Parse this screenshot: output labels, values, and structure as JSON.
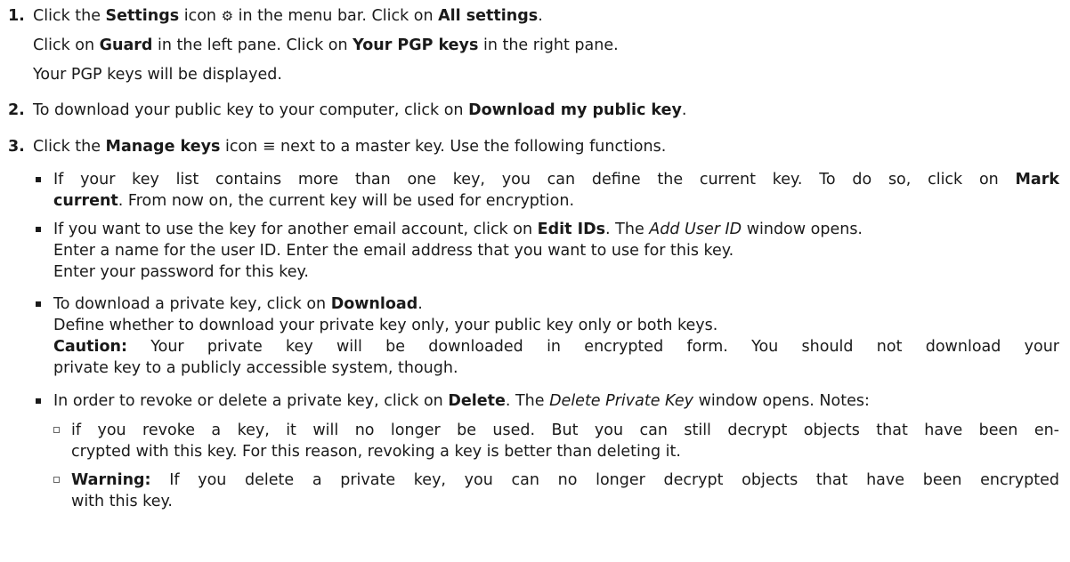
{
  "steps": [
    {
      "number": "1.",
      "lines": [
        [
          "Click the ",
          {
            "b": "Settings"
          },
          " icon ",
          {
            "icon": "⚙"
          },
          " in the menu bar. Click on ",
          {
            "b": "All settings"
          },
          "."
        ],
        [
          "Click on ",
          {
            "b": "Guard"
          },
          " in the left pane. Click on ",
          {
            "b": "Your PGP keys"
          },
          " in the right pane."
        ],
        [
          "Your PGP keys will be displayed."
        ]
      ]
    },
    {
      "number": "2.",
      "lines": [
        [
          "To download your public key to your computer, click on ",
          {
            "b": "Download my public key"
          },
          "."
        ]
      ]
    },
    {
      "number": "3.",
      "lines": [
        [
          "Click the ",
          {
            "b": "Manage keys"
          },
          " icon ",
          {
            "icon": "≡"
          },
          " next to a master key. Use the following functions."
        ]
      ]
    }
  ],
  "bullets": [
    {
      "lines": [
        [
          "If your key list contains more than one key, you can define the current key. To do so, click on ",
          {
            "b": "Mark"
          }
        ],
        [
          {
            "b": "current"
          },
          ". From now on, the current key will be used for encryption."
        ]
      ],
      "justify_first": true
    },
    {
      "lines": [
        [
          "If you want to use the key for another email account, click on ",
          {
            "b": "Edit IDs"
          },
          ". The ",
          {
            "i": "Add User ID"
          },
          " window opens."
        ],
        [
          "Enter a name for the user ID. Enter the email address that you want to use for this key."
        ],
        [
          "Enter your password for this key."
        ]
      ]
    },
    {
      "lines": [
        [
          "To download a private key, click on ",
          {
            "b": "Download"
          },
          "."
        ],
        [
          "Define whether to download your private key only, your public key only or both keys."
        ],
        [
          {
            "b": "Caution:"
          },
          " Your private key will be downloaded in encrypted form. You should not download your"
        ],
        [
          "private key to a publicly accessible system, though."
        ]
      ],
      "justify_line": 2
    },
    {
      "lines": [
        [
          "In order to revoke or delete a private key, click on ",
          {
            "b": "Delete"
          },
          ". The ",
          {
            "i": "Delete Private Key"
          },
          " window opens. Notes:"
        ]
      ]
    }
  ],
  "subbullets": [
    {
      "lines": [
        [
          "if you revoke a key, it will no longer be used. But you can still decrypt objects that have been en-"
        ],
        [
          "crypted with this key. For this reason, revoking a key is better than deleting it."
        ]
      ],
      "justify_first": true
    },
    {
      "lines": [
        [
          {
            "b": "Warning:"
          },
          " If you delete a private key, you can no longer decrypt objects that have been encrypted"
        ],
        [
          "with this key."
        ]
      ],
      "justify_first": true
    }
  ]
}
